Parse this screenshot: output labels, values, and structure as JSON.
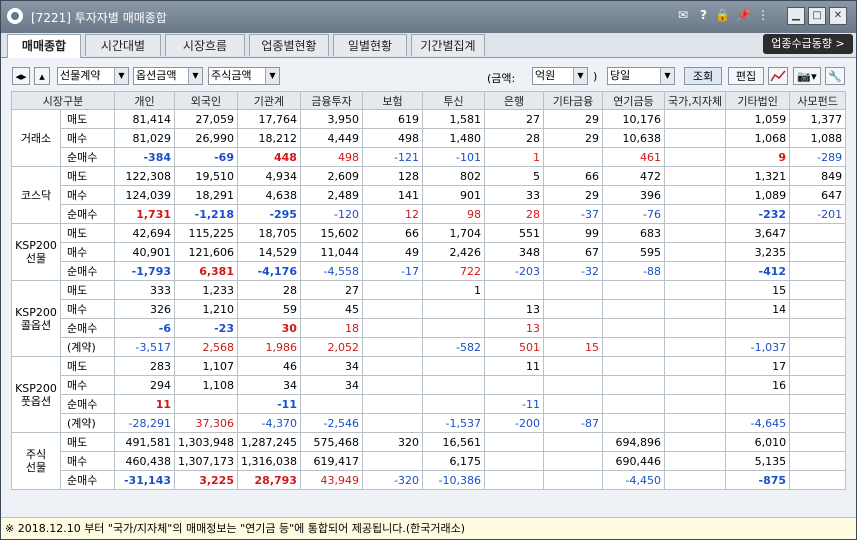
{
  "window": {
    "title": "[7221] 투자자별 매매종합",
    "icons": [
      "✉",
      "?",
      "🔒",
      "📌",
      "⋮"
    ]
  },
  "tabs": [
    {
      "label": "매매종합",
      "active": true
    },
    {
      "label": "시간대별",
      "active": false
    },
    {
      "label": "시장흐름",
      "active": false
    },
    {
      "label": "업종별현황",
      "active": false
    },
    {
      "label": "일별현황",
      "active": false
    },
    {
      "label": "기간별집계",
      "active": false
    }
  ],
  "right_button": "업종수급동향 >",
  "toolbar": {
    "combo1": "선물계약",
    "combo2": "옵션금액",
    "combo3": "주식금액",
    "amount_label": "(금액:",
    "amount_value": "억원",
    "amount_close": ")",
    "period_value": "당일",
    "query_button": "조회",
    "edit_button": "편집"
  },
  "columns": [
    "시장구분",
    "개인",
    "외국인",
    "기관계",
    "금융투자",
    "보험",
    "투신",
    "은행",
    "기타금융",
    "연기금등",
    "국가,지자체",
    "기타법인",
    "사모펀드"
  ],
  "markets": [
    {
      "name": "거래소",
      "rows": [
        {
          "label": "매도",
          "values": [
            "81,414",
            "27,059",
            "17,764",
            "3,950",
            "619",
            "1,581",
            "27",
            "29",
            "10,176",
            "",
            "1,059",
            "1,377"
          ]
        },
        {
          "label": "매수",
          "values": [
            "81,029",
            "26,990",
            "18,212",
            "4,449",
            "498",
            "1,480",
            "28",
            "29",
            "10,638",
            "",
            "1,068",
            "1,088"
          ]
        },
        {
          "label": "순매수",
          "values": [
            "-384",
            "-69",
            "448",
            "498",
            "-121",
            "-101",
            "1",
            "",
            "461",
            "",
            "9",
            "-289"
          ]
        }
      ]
    },
    {
      "name": "코스닥",
      "rows": [
        {
          "label": "매도",
          "values": [
            "122,308",
            "19,510",
            "4,934",
            "2,609",
            "128",
            "802",
            "5",
            "66",
            "472",
            "",
            "1,321",
            "849"
          ]
        },
        {
          "label": "매수",
          "values": [
            "124,039",
            "18,291",
            "4,638",
            "2,489",
            "141",
            "901",
            "33",
            "29",
            "396",
            "",
            "1,089",
            "647"
          ]
        },
        {
          "label": "순매수",
          "values": [
            "1,731",
            "-1,218",
            "-295",
            "-120",
            "12",
            "98",
            "28",
            "-37",
            "-76",
            "",
            "-232",
            "-201"
          ]
        }
      ]
    },
    {
      "name": "KSP200\n선물",
      "rows": [
        {
          "label": "매도",
          "values": [
            "42,694",
            "115,225",
            "18,705",
            "15,602",
            "66",
            "1,704",
            "551",
            "99",
            "683",
            "",
            "3,647",
            ""
          ]
        },
        {
          "label": "매수",
          "values": [
            "40,901",
            "121,606",
            "14,529",
            "11,044",
            "49",
            "2,426",
            "348",
            "67",
            "595",
            "",
            "3,235",
            ""
          ]
        },
        {
          "label": "순매수",
          "values": [
            "-1,793",
            "6,381",
            "-4,176",
            "-4,558",
            "-17",
            "722",
            "-203",
            "-32",
            "-88",
            "",
            "-412",
            ""
          ]
        }
      ]
    },
    {
      "name": "KSP200\n콜옵션",
      "rows": [
        {
          "label": "매도",
          "values": [
            "333",
            "1,233",
            "28",
            "27",
            "",
            "1",
            "",
            "",
            "",
            "",
            "15",
            ""
          ]
        },
        {
          "label": "매수",
          "values": [
            "326",
            "1,210",
            "59",
            "45",
            "",
            "",
            "13",
            "",
            "",
            "",
            "14",
            ""
          ]
        },
        {
          "label": "순매수",
          "values": [
            "-6",
            "-23",
            "30",
            "18",
            "",
            "",
            "13",
            "",
            "",
            "",
            "",
            ""
          ]
        },
        {
          "label": "(계약)",
          "values": [
            "-3,517",
            "2,568",
            "1,986",
            "2,052",
            "",
            "-582",
            "501",
            "15",
            "",
            "",
            "-1,037",
            ""
          ]
        }
      ]
    },
    {
      "name": "KSP200\n풋옵션",
      "rows": [
        {
          "label": "매도",
          "values": [
            "283",
            "1,107",
            "46",
            "34",
            "",
            "",
            "11",
            "",
            "",
            "",
            "17",
            ""
          ]
        },
        {
          "label": "매수",
          "values": [
            "294",
            "1,108",
            "34",
            "34",
            "",
            "",
            "",
            "",
            "",
            "",
            "16",
            ""
          ]
        },
        {
          "label": "순매수",
          "values": [
            "11",
            "",
            "-11",
            "",
            "",
            "",
            "-11",
            "",
            "",
            "",
            "",
            ""
          ]
        },
        {
          "label": "(계약)",
          "values": [
            "-28,291",
            "37,306",
            "-4,370",
            "-2,546",
            "",
            "-1,537",
            "-200",
            "-87",
            "",
            "",
            "-4,645",
            ""
          ]
        }
      ]
    },
    {
      "name": "주식\n선물",
      "rows": [
        {
          "label": "매도",
          "values": [
            "491,581",
            "1,303,948",
            "1,287,245",
            "575,468",
            "320",
            "16,561",
            "",
            "",
            "694,896",
            "",
            "6,010",
            ""
          ]
        },
        {
          "label": "매수",
          "values": [
            "460,438",
            "1,307,173",
            "1,316,038",
            "619,417",
            "",
            "6,175",
            "",
            "",
            "690,446",
            "",
            "5,135",
            ""
          ]
        },
        {
          "label": "순매수",
          "values": [
            "-31,143",
            "3,225",
            "28,793",
            "43,949",
            "-320",
            "-10,386",
            "",
            "",
            "-4,450",
            "",
            "-875",
            ""
          ]
        }
      ]
    }
  ],
  "footer": "※ 2018.12.10 부터 \"국가/지자체\"의 매매정보는 \"연기금 등\"에 통합되어 제공됩니다.(한국거래소)"
}
